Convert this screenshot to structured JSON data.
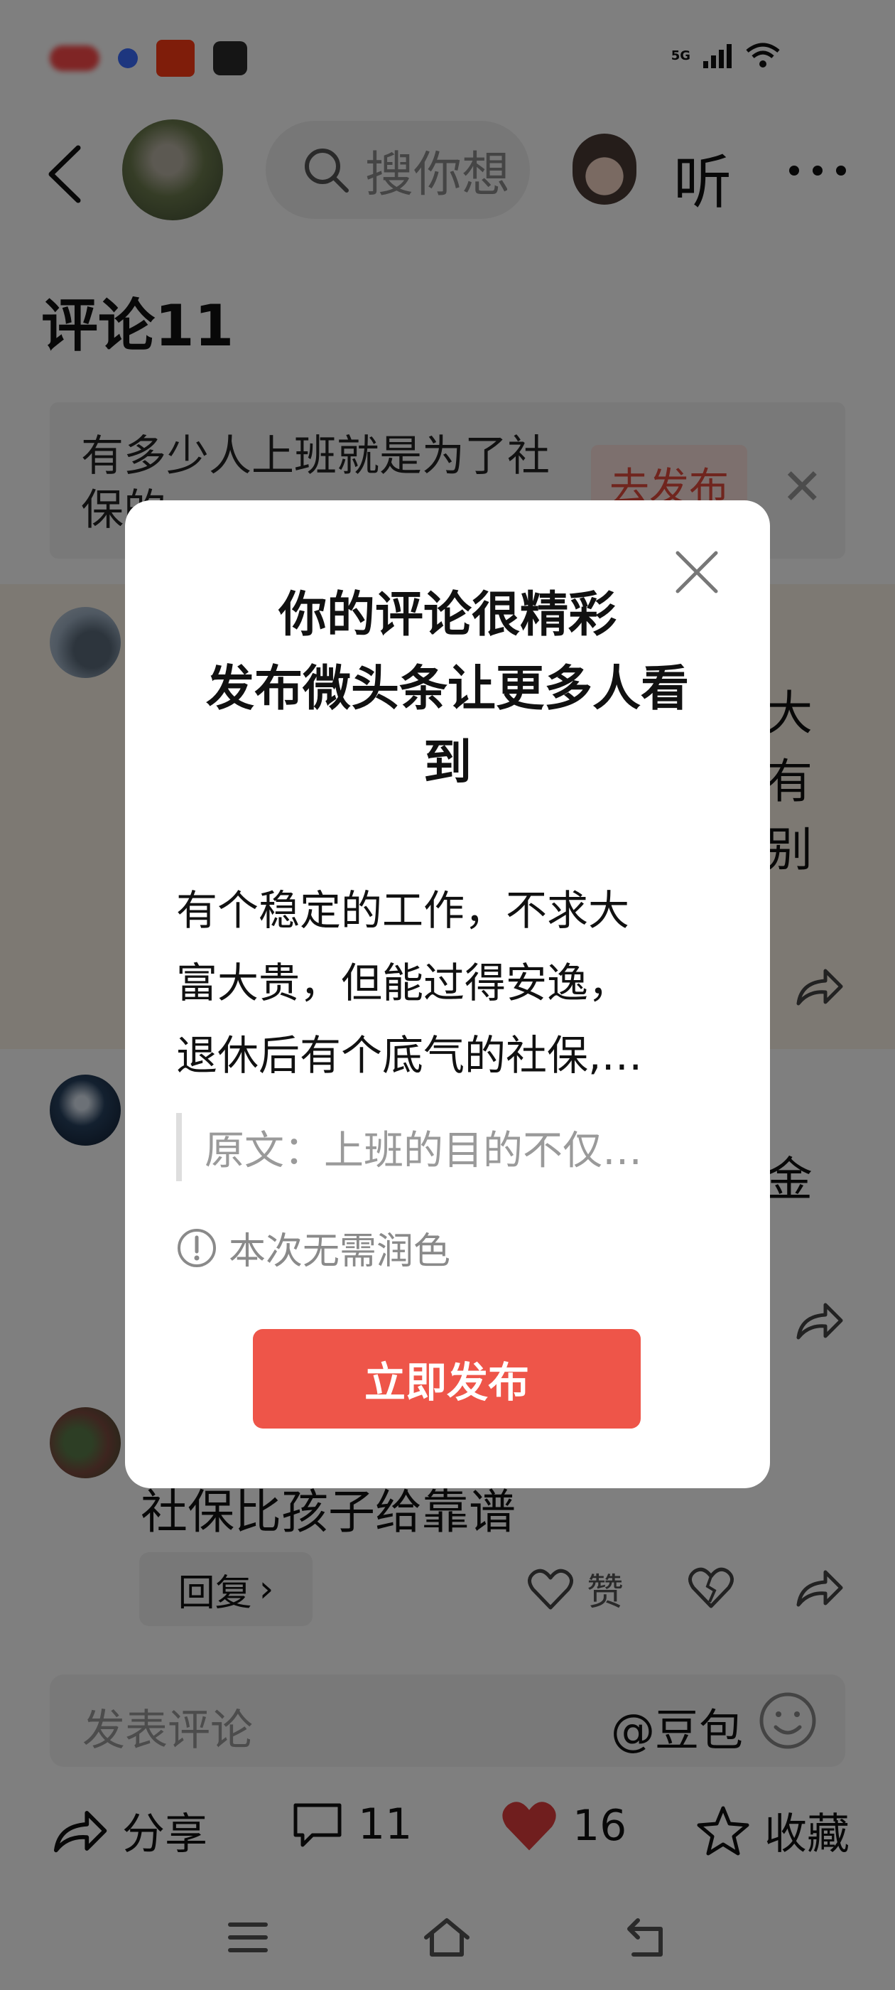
{
  "status_bar": {
    "network": "5G"
  },
  "header": {
    "search_placeholder": "搜你想",
    "listen_label": "听"
  },
  "comments": {
    "title": "评论11",
    "topic_banner": {
      "text": "有多少人上班就是为了社保的",
      "post_button": "去发布"
    },
    "peek_right": [
      "大",
      "有",
      "别",
      "金"
    ],
    "third_comment_text": "社保比孩子给靠谱",
    "reply_label": "回复",
    "like_label": "赞"
  },
  "comment_input": {
    "placeholder": "发表评论",
    "mention": "@豆包"
  },
  "bottom_actions": {
    "share_label": "分享",
    "comment_count": "11",
    "like_count": "16",
    "favorite_label": "收藏"
  },
  "modal": {
    "title_lines": [
      "你的评论很精彩",
      "发布微头条让更多人看",
      "到"
    ],
    "body_lines": [
      "有个稳定的工作，不求大",
      "富大贵，但能过得安逸，",
      "退休后有个底气的社保,…"
    ],
    "original_quote": "原文：上班的目的不仅…",
    "info_text": "本次无需润色",
    "publish_button": "立即发布"
  },
  "colors": {
    "accent_red": "#ee5549",
    "overlay": "rgba(0,0,0,0.5)",
    "heart_red": "#e03c3c"
  }
}
